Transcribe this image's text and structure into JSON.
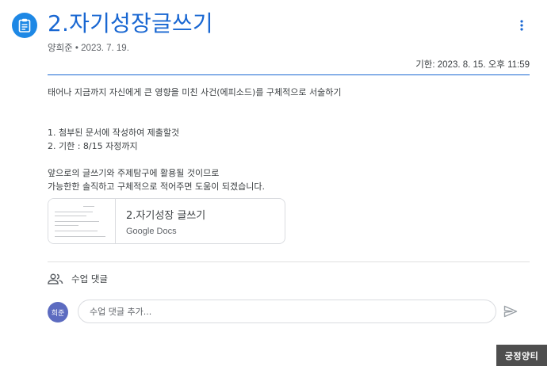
{
  "assignment": {
    "icon": "assignment-icon",
    "title": "2.자기성장글쓰기",
    "author_date": "양희준 • 2023. 7. 19.",
    "due": "기한: 2023. 8. 15. 오후 11:59"
  },
  "description": {
    "lines": [
      "태어나 지금까지 자신에게 큰 영향을 미친 사건(에피소드)를 구체적으로 서술하기",
      "",
      "",
      "1. 첨부된 문서에 작성하여 제출할것",
      "2. 기한 : 8/15 자정까지",
      "",
      "앞으로의 글쓰기와 주제탐구에 활용될 것이므로",
      "가능한한 솔직하고 구체적으로 적어주면 도움이 되겠습니다."
    ]
  },
  "attachment": {
    "title": "2.자기성장 글쓰기",
    "type": "Google Docs"
  },
  "comments": {
    "header": "수업 댓글",
    "avatar_initials": "희준",
    "placeholder": "수업 댓글 추가..."
  },
  "watermark": "궁정양티",
  "colors": {
    "accent": "#1967d2",
    "icon_bg": "#1e88e5",
    "avatar_bg": "#5c6bc0"
  }
}
